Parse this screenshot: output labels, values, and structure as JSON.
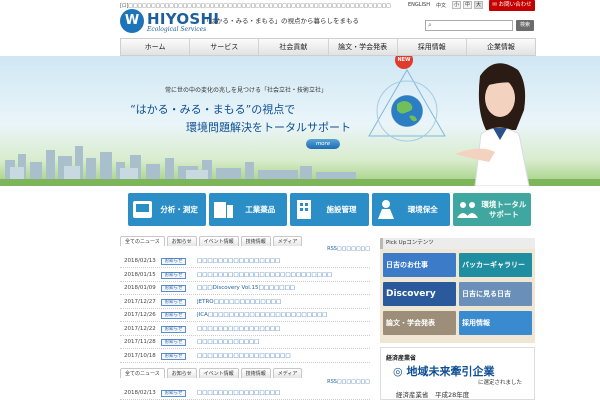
{
  "header": {
    "topline": "[ロ]□□□□□□□□□□□□□□□□□□□□□□□□□□□□□□□□□□□□□□□□□□□□□□□□□□□□□□□□□□",
    "logo_name": "HIYOSHI",
    "logo_sub": "Ecological Services",
    "tagline": "「はかる・みる・まもる」の視点から暮らしをまもる",
    "english": "ENGLISH",
    "chinese": "中文",
    "font_sizes": [
      "小",
      "中",
      "大"
    ],
    "contact": "お問い合わせ",
    "search_placeholder": "",
    "search_button": "検索"
  },
  "nav": [
    "ホーム",
    "サービス",
    "社会貢献",
    "論文・学会発表",
    "採用情報",
    "企業情報"
  ],
  "hero": {
    "small": "常に世の中の変化の兆しを見つける「社会立社・技術立社」",
    "line1": "“はかる・みる・まもる”の視点で",
    "line2": "環境問題解決をトータルサポート",
    "more": "more",
    "new_badge": "NEW"
  },
  "categories": [
    {
      "label": "分析・測定",
      "color": "#2b8ec6",
      "icon": "analysis-icon"
    },
    {
      "label": "工業薬品",
      "color": "#2b8ec6",
      "icon": "chemical-icon"
    },
    {
      "label": "施設管理",
      "color": "#2b8ec6",
      "icon": "building-icon"
    },
    {
      "label": "環境保全",
      "color": "#2b8ec6",
      "icon": "worker-icon"
    },
    {
      "label": "環境トータル\nサポート",
      "color": "#3fa79f",
      "icon": "people-icon"
    }
  ],
  "news_tabs": [
    "全てのニュース",
    "お知らせ",
    "イベント情報",
    "技術情報",
    "メディア"
  ],
  "rss": "RSS□□□□□□□",
  "news": [
    {
      "date": "2018/02/13",
      "badge": "お知らせ",
      "title": "□□□□□□□□□□□□□□□□"
    },
    {
      "date": "2018/01/15",
      "badge": "お知らせ",
      "title": "□□□□□□□□□□□□□□□□□□□□□□□□□□"
    },
    {
      "date": "2018/01/09",
      "badge": "お知らせ",
      "title": "□□□Discovery Vol.15□□□□□□□"
    },
    {
      "date": "2017/12/27",
      "badge": "お知らせ",
      "title": "JETRO□□□□□□□□□□□□□"
    },
    {
      "date": "2017/12/26",
      "badge": "お知らせ",
      "title": "JICA□□□□□□□□□□□□□□□□□□□□□□□"
    },
    {
      "date": "2017/12/22",
      "badge": "お知らせ",
      "title": "□□□□□□□□□□□□□□□□"
    },
    {
      "date": "2017/11/28",
      "badge": "お知らせ",
      "title": "□□□□□□□□□□□□"
    },
    {
      "date": "2017/10/18",
      "badge": "お知らせ",
      "title": "□□□□□□□□□□□□□□□□□□"
    }
  ],
  "news2": [
    {
      "date": "2018/02/13",
      "badge": "お知らせ",
      "title": "□□□□□□□□□□□□□□□□"
    }
  ],
  "pickup": {
    "heading": "Pick Upコンテンツ",
    "banners": [
      {
        "label": "日吉のお仕事",
        "color": "#3b7bc8"
      },
      {
        "label": "バッカーギャラリー",
        "color": "#1f8ea0"
      },
      {
        "label": "Discovery",
        "color": "#2a5a9c"
      },
      {
        "label": "日吉に見る日吉",
        "color": "#6a8fb8"
      },
      {
        "label": "論文・学会発表",
        "color": "#9c8e79"
      },
      {
        "label": "採用情報",
        "color": "#3a8ad0"
      }
    ]
  },
  "meti": {
    "top": "経済産業省",
    "main": "地域未来牽引企業",
    "sub": "に選定されました",
    "bottom": "経済産業省　平成28年度"
  },
  "colors": {
    "accent": "#1d74b8",
    "contact": "#c40000",
    "nav_bg": "#e8e8e8"
  }
}
